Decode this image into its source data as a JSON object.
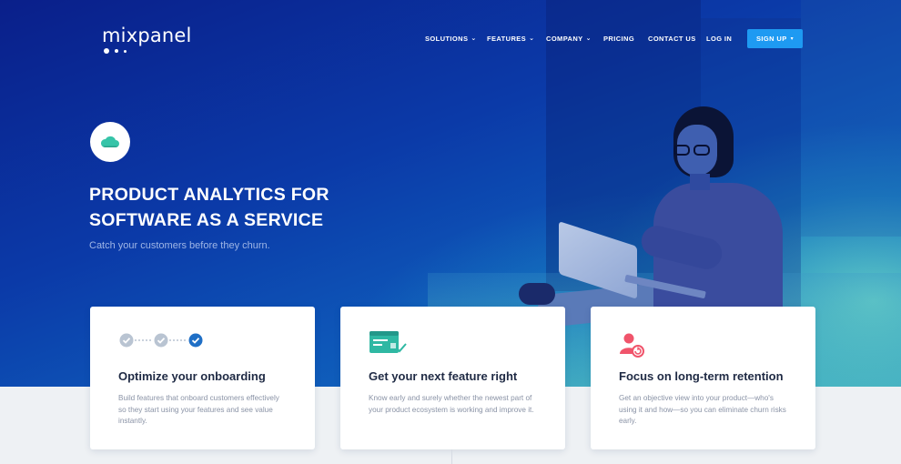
{
  "brand": {
    "name": "mixpanel"
  },
  "nav": {
    "items": [
      {
        "label": "SOLUTIONS",
        "has_dropdown": true
      },
      {
        "label": "FEATURES",
        "has_dropdown": true
      },
      {
        "label": "COMPANY",
        "has_dropdown": true
      },
      {
        "label": "PRICING",
        "has_dropdown": false
      },
      {
        "label": "CONTACT US",
        "has_dropdown": false
      },
      {
        "label": "LOG IN",
        "has_dropdown": false
      }
    ],
    "signup_label": "SIGN UP",
    "signup_icon": "chevron-down-icon"
  },
  "hero": {
    "badge_icon": "cloud-icon",
    "headline_line1": "PRODUCT ANALYTICS FOR",
    "headline_line2": "SOFTWARE AS A SERVICE",
    "subline": "Catch your customers before they churn."
  },
  "cards": [
    {
      "icon": "onboarding-steps-icon",
      "title": "Optimize your onboarding",
      "description": "Build features that onboard customers effectively so they start using your features and see value instantly."
    },
    {
      "icon": "browser-feature-icon",
      "title": "Get your next feature right",
      "description": "Know early and surely whether the newest part of your product ecosystem is working and improve it."
    },
    {
      "icon": "user-retention-icon",
      "title": "Focus on long-term retention",
      "description": "Get an objective view into your product—who's using it and how—so you can eliminate churn risks early."
    }
  ],
  "colors": {
    "hero_start": "#0a1f8a",
    "hero_end": "#1479c4",
    "accent": "#1e9af2",
    "check_gray": "#b9c4d2",
    "check_blue": "#1f6fc6",
    "icon_teal": "#2fb8a3",
    "icon_red": "#f0546b"
  }
}
